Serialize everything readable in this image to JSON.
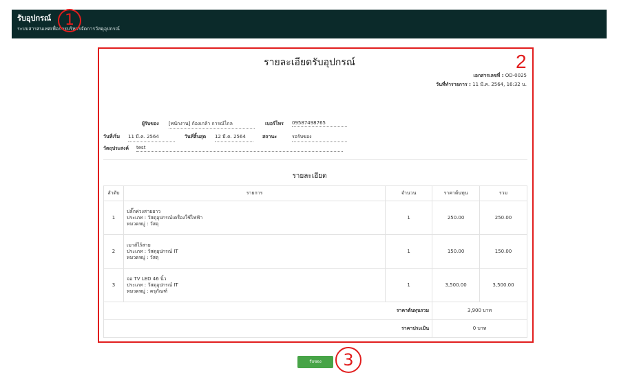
{
  "header": {
    "title": "รับอุปกรณ์",
    "subtitle": "ระบบสารสนเทศเพื่อการบริหารจัดการวัสดุอุปกรณ์"
  },
  "markers": {
    "m1": "1",
    "m2": "2",
    "m3": "3"
  },
  "document": {
    "title": "รายละเอียดรับอุปกรณ์",
    "doc_no_label": "เอกสารเลขที่ :",
    "doc_no": "OD-0025",
    "tx_date_label": "วันที่ทำรายการ :",
    "tx_date": "11 มี.ค. 2564, 16:32 น.",
    "requester_label": "ผู้รับของ",
    "requester": "[พนักงาน] ก้องเกล้า การณ์ไกล",
    "phone_label": "เบอร์โทร",
    "phone": "09587498765",
    "start_label": "วันที่เริ่ม",
    "start": "11 มี.ค. 2564",
    "end_label": "วันที่สิ้นสุด",
    "end": "12 มี.ค. 2564",
    "status_label": "สถานะ",
    "status": "รอรับของ",
    "purpose_label": "วัตถุประสงค์",
    "purpose": "test",
    "detail_heading": "รายละเอียด"
  },
  "table": {
    "headers": [
      "ลำดับ",
      "รายการ",
      "จำนวน",
      "ราคาต้นทุน",
      "รวม"
    ],
    "rows": [
      {
        "no": "1",
        "name": "ปลั๊กพ่วงสายยาว",
        "type": "ประเภท : วัสดุอุปกรณ์เครื่องใช้ไฟฟ้า",
        "category": "หมวดหมู่ : วัสดุ",
        "qty": "1",
        "price": "250.00",
        "total": "250.00"
      },
      {
        "no": "2",
        "name": "เมาส์ไร้สาย",
        "type": "ประเภท : วัสดุอุปกรณ์ IT",
        "category": "หมวดหมู่ : วัสดุ",
        "qty": "1",
        "price": "150.00",
        "total": "150.00"
      },
      {
        "no": "3",
        "name": "จอ TV LED 46 นิ้ว",
        "type": "ประเภท : วัสดุอุปกรณ์ IT",
        "category": "หมวดหมู่ : ครุภัณฑ์",
        "qty": "1",
        "price": "3,500.00",
        "total": "3,500.00"
      }
    ],
    "sum_cost_label": "ราคาต้นทุนรวม",
    "sum_cost": "3,900 บาท",
    "appraised_label": "ราคาประเมิน",
    "appraised": "0 บาท"
  },
  "actions": {
    "receive_label": "รับของ"
  }
}
